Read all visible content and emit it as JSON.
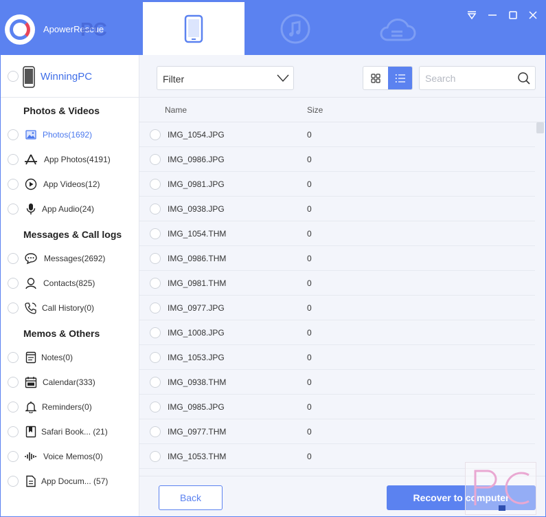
{
  "app": {
    "title": "ApowerRescue",
    "watermark": "PC",
    "colors": {
      "accent": "#5b82f0",
      "active_text": "#4a78ee",
      "panel_bg": "#f3f5fb"
    }
  },
  "header": {
    "tabs": [
      {
        "name": "device-tab",
        "icon": "phone-icon",
        "active": true
      },
      {
        "name": "itunes-tab",
        "icon": "music-icon",
        "active": false
      },
      {
        "name": "icloud-tab",
        "icon": "cloud-icon",
        "active": false
      }
    ],
    "window_controls": [
      "menu-icon",
      "minimize-icon",
      "maximize-icon",
      "close-icon"
    ]
  },
  "sidebar": {
    "device_name": "WinningPC",
    "sections": [
      {
        "title": "Photos & Videos",
        "items": [
          {
            "label": "Photos(1692)",
            "icon": "image-icon",
            "active": true
          },
          {
            "label": "App Photos(4191)",
            "icon": "app-store-icon",
            "active": false
          },
          {
            "label": "App Videos(12)",
            "icon": "play-icon",
            "active": false
          },
          {
            "label": "App Audio(24)",
            "icon": "microphone-icon",
            "active": false
          }
        ]
      },
      {
        "title": "Messages & Call logs",
        "items": [
          {
            "label": "Messages(2692)",
            "icon": "chat-icon",
            "active": false
          },
          {
            "label": "Contacts(825)",
            "icon": "contact-icon",
            "active": false
          },
          {
            "label": "Call History(0)",
            "icon": "phone-call-icon",
            "active": false
          }
        ]
      },
      {
        "title": "Memos & Others",
        "items": [
          {
            "label": "Notes(0)",
            "icon": "note-icon",
            "active": false
          },
          {
            "label": "Calendar(333)",
            "icon": "calendar-icon",
            "active": false
          },
          {
            "label": "Reminders(0)",
            "icon": "bell-icon",
            "active": false
          },
          {
            "label": "Safari Book... (21)",
            "icon": "bookmark-icon",
            "active": false
          },
          {
            "label": "Voice Memos(0)",
            "icon": "waveform-icon",
            "active": false
          },
          {
            "label": "App Docum... (57)",
            "icon": "document-icon",
            "active": false
          }
        ]
      }
    ]
  },
  "toolbar": {
    "filter_label": "Filter",
    "search_placeholder": "Search",
    "view_mode": "list"
  },
  "table": {
    "columns": [
      "Name",
      "Size"
    ],
    "rows": [
      {
        "name": "IMG_1054.JPG",
        "size": "0"
      },
      {
        "name": "IMG_0986.JPG",
        "size": "0"
      },
      {
        "name": "IMG_0981.JPG",
        "size": "0"
      },
      {
        "name": "IMG_0938.JPG",
        "size": "0"
      },
      {
        "name": "IMG_1054.THM",
        "size": "0"
      },
      {
        "name": "IMG_0986.THM",
        "size": "0"
      },
      {
        "name": "IMG_0981.THM",
        "size": "0"
      },
      {
        "name": "IMG_0977.JPG",
        "size": "0"
      },
      {
        "name": "IMG_1008.JPG",
        "size": "0"
      },
      {
        "name": "IMG_1053.JPG",
        "size": "0"
      },
      {
        "name": "IMG_0938.THM",
        "size": "0"
      },
      {
        "name": "IMG_0985.JPG",
        "size": "0"
      },
      {
        "name": "IMG_0977.THM",
        "size": "0"
      },
      {
        "name": "IMG_1053.THM",
        "size": "0"
      }
    ]
  },
  "footer": {
    "back_label": "Back",
    "recover_label": "Recover to computer"
  }
}
